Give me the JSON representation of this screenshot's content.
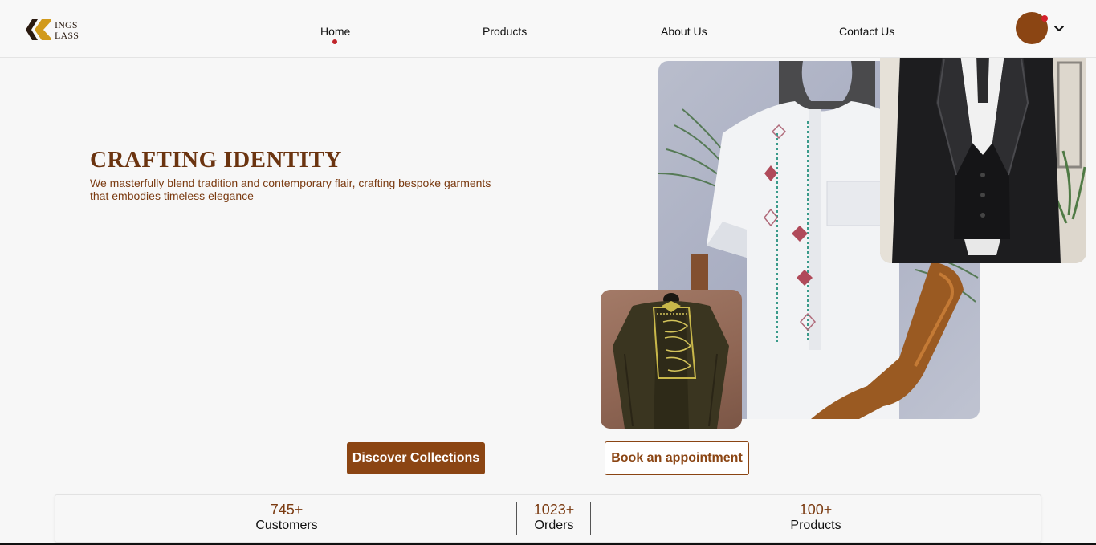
{
  "brand": {
    "logo_text_line1": "INGS",
    "logo_text_line2": "LASS",
    "primary_color": "#8b4513",
    "text_color": "#6b3410",
    "accent_dot_color": "#c0242a"
  },
  "nav": {
    "items": [
      {
        "label": "Home",
        "active": true
      },
      {
        "label": "Products",
        "active": false
      },
      {
        "label": "About Us",
        "active": false
      },
      {
        "label": "Contact Us",
        "active": false
      }
    ]
  },
  "user_menu": {
    "avatar_icon": "avatar",
    "notification_dot": true,
    "chevron_icon": "chevron-down-icon"
  },
  "hero": {
    "title": "CRAFTING IDENTITY",
    "subtitle": "We masterfully blend tradition and contemporary flair, crafting bespoke garments that embodies timeless elegance"
  },
  "images": {
    "main": "white-embroidered-kaftan-image",
    "suit": "black-three-piece-suit-image",
    "agbada": "olive-embroidered-agbada-image"
  },
  "buttons": {
    "discover": "Discover Collections",
    "book": "Book an appointment"
  },
  "stats": [
    {
      "value": "745+",
      "label": "Customers"
    },
    {
      "value": "1023+",
      "label": "Orders"
    },
    {
      "value": "100+",
      "label": "Products"
    }
  ]
}
